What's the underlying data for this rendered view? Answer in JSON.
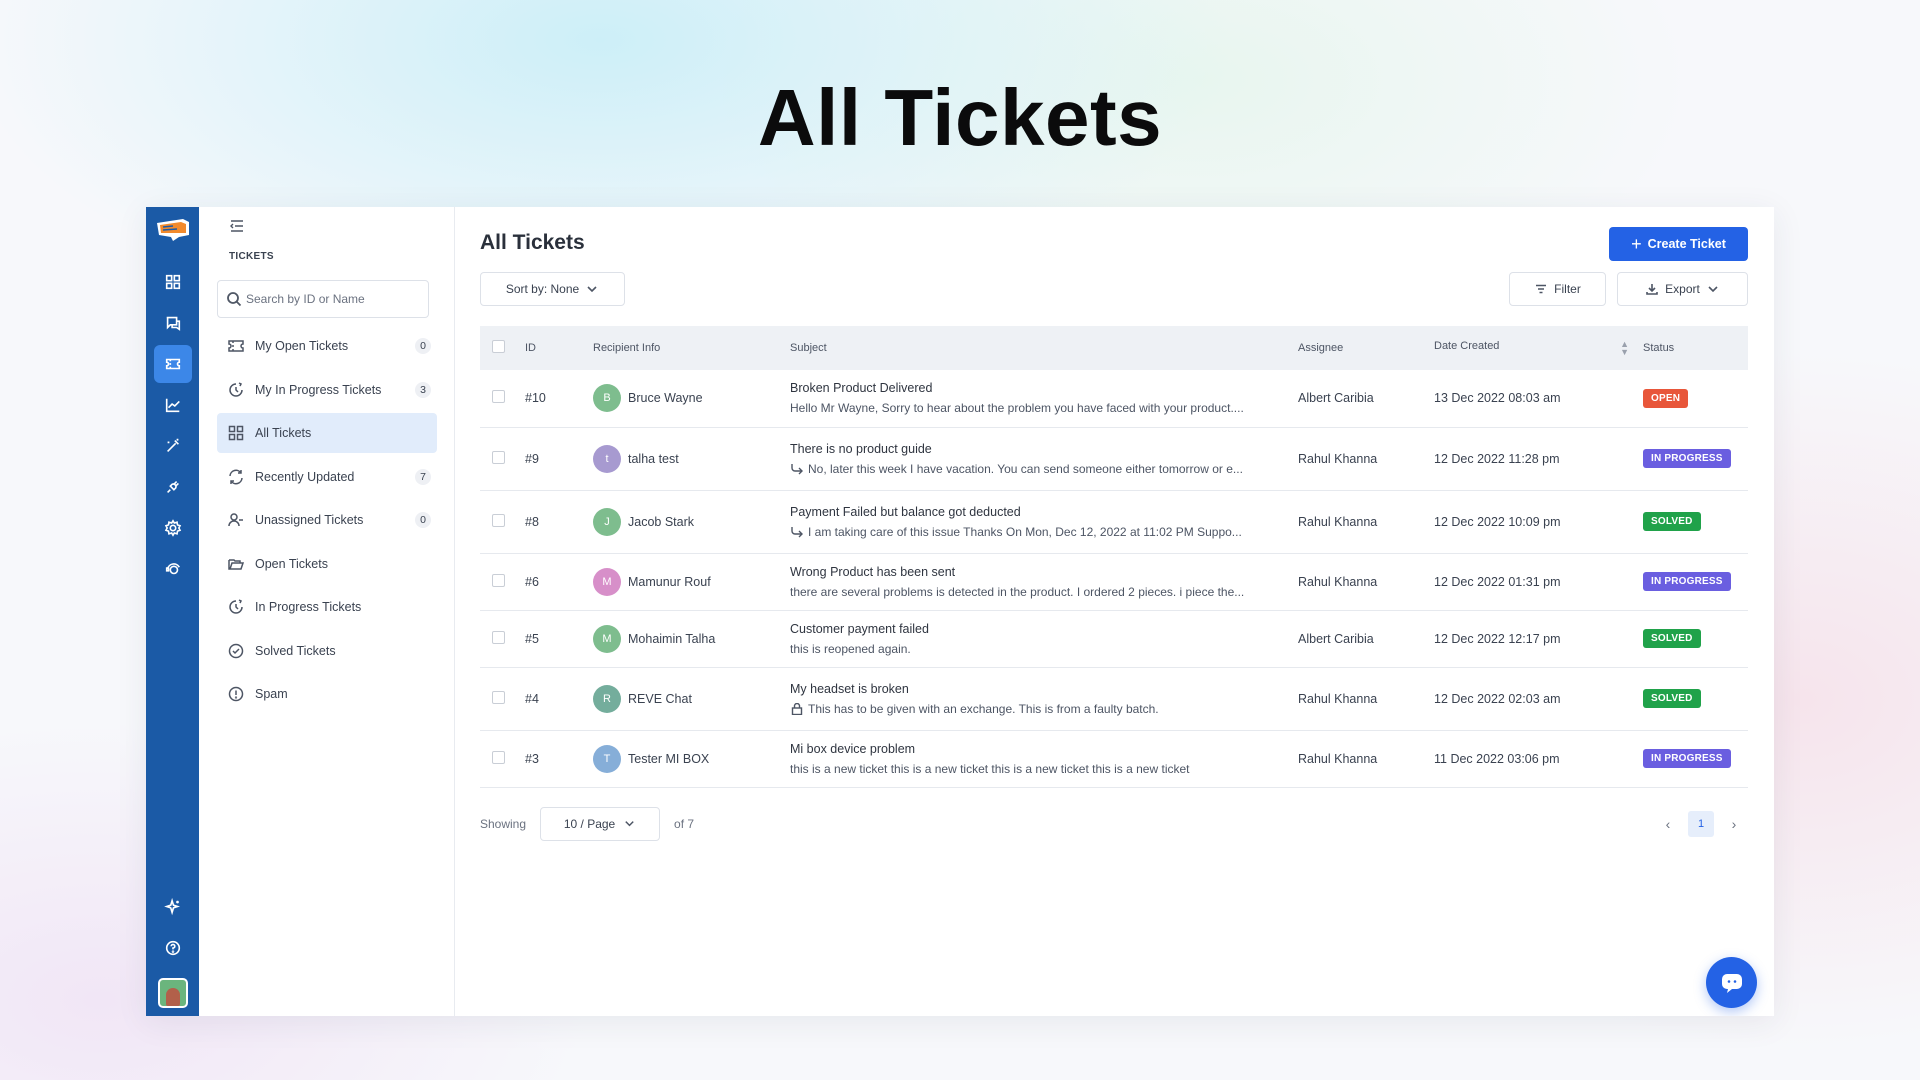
{
  "hero_title": "All Tickets",
  "colors": {
    "rail": "#1b5aa6",
    "primary": "#2462e5",
    "open": "#e8563a",
    "in_progress": "#6a5ee0",
    "solved": "#20a24a"
  },
  "rail": {
    "items": [
      {
        "name": "dashboard-icon"
      },
      {
        "name": "chat-icon"
      },
      {
        "name": "ticket-icon",
        "active": true
      },
      {
        "name": "analytics-icon"
      },
      {
        "name": "magic-wand-icon"
      },
      {
        "name": "plugin-icon"
      },
      {
        "name": "settings-icon"
      },
      {
        "name": "support-agent-icon"
      }
    ],
    "bottom": [
      {
        "name": "sparkle-icon"
      },
      {
        "name": "help-icon"
      }
    ]
  },
  "sidebar": {
    "heading": "TICKETS",
    "search_placeholder": "Search by ID or Name",
    "items": [
      {
        "label": "My Open Tickets",
        "count": "0",
        "icon": "ticket-icon"
      },
      {
        "label": "My In Progress Tickets",
        "count": "3",
        "icon": "progress-icon"
      },
      {
        "label": "All Tickets",
        "count": "",
        "icon": "grid-icon",
        "active": true
      },
      {
        "label": "Recently Updated",
        "count": "7",
        "icon": "refresh-icon"
      },
      {
        "label": "Unassigned Tickets",
        "count": "0",
        "icon": "user-minus-icon"
      },
      {
        "label": "Open Tickets",
        "count": "",
        "icon": "folder-open-icon"
      },
      {
        "label": "In Progress Tickets",
        "count": "",
        "icon": "progress-icon"
      },
      {
        "label": "Solved Tickets",
        "count": "",
        "icon": "check-circle-icon"
      },
      {
        "label": "Spam",
        "count": "",
        "icon": "alert-circle-icon"
      }
    ]
  },
  "main": {
    "title": "All Tickets",
    "create_label": "Create Ticket",
    "sort_label": "Sort by: None",
    "filter_label": "Filter",
    "export_label": "Export"
  },
  "table": {
    "columns": [
      "ID",
      "Recipient Info",
      "Subject",
      "Assignee",
      "Date Created",
      "Status"
    ],
    "rows": [
      {
        "id": "#10",
        "initial": "B",
        "avatar_color": "#7ebd8e",
        "recipient": "Bruce Wayne",
        "subject": "Broken Product Delivered",
        "snippet": "Hello Mr Wayne, Sorry to hear about the problem you have faced with your product....",
        "snippet_icon": "",
        "assignee": "Albert Caribia",
        "date": "13 Dec 2022 08:03 am",
        "status": "OPEN",
        "status_color": "#e8563a"
      },
      {
        "id": "#9",
        "initial": "t",
        "avatar_color": "#a79ad0",
        "recipient": "talha test",
        "subject": "There is no product guide",
        "snippet": "No, later this week I have vacation. You can send someone either tomorrow or e...",
        "snippet_icon": "reply-icon",
        "assignee": "Rahul Khanna",
        "date": "12 Dec 2022 11:28 pm",
        "status": "IN PROGRESS",
        "status_color": "#6a5ee0"
      },
      {
        "id": "#8",
        "initial": "J",
        "avatar_color": "#7ebd8e",
        "recipient": "Jacob Stark",
        "subject": "Payment Failed but balance got deducted",
        "snippet": "I am taking care of this issue Thanks On Mon, Dec 12, 2022 at 11:02 PM Suppo...",
        "snippet_icon": "reply-icon",
        "assignee": "Rahul Khanna",
        "date": "12 Dec 2022 10:09 pm",
        "status": "SOLVED",
        "status_color": "#20a24a"
      },
      {
        "id": "#6",
        "initial": "M",
        "avatar_color": "#d78fc9",
        "recipient": "Mamunur Rouf",
        "subject": "Wrong Product has been sent",
        "snippet": "there are several problems is detected in the product. I ordered 2 pieces. i piece the...",
        "snippet_icon": "",
        "assignee": "Rahul Khanna",
        "date": "12 Dec 2022 01:31 pm",
        "status": "IN PROGRESS",
        "status_color": "#6a5ee0"
      },
      {
        "id": "#5",
        "initial": "M",
        "avatar_color": "#7ebd8e",
        "recipient": "Mohaimin Talha",
        "subject": "Customer payment failed",
        "snippet": "this is reopened again.",
        "snippet_icon": "",
        "assignee": "Albert Caribia",
        "date": "12 Dec 2022 12:17 pm",
        "status": "SOLVED",
        "status_color": "#20a24a"
      },
      {
        "id": "#4",
        "initial": "R",
        "avatar_color": "#74ad9c",
        "recipient": "REVE Chat",
        "subject": "My headset is broken",
        "snippet": "This has to be given with an exchange. This is from a faulty batch.",
        "snippet_icon": "lock-icon",
        "assignee": "Rahul Khanna",
        "date": "12 Dec 2022 02:03 am",
        "status": "SOLVED",
        "status_color": "#20a24a"
      },
      {
        "id": "#3",
        "initial": "T",
        "avatar_color": "#86aed8",
        "recipient": "Tester MI BOX",
        "subject": "Mi box device problem",
        "snippet": "this is a new ticket this is a new ticket this is a new ticket this is a new ticket",
        "snippet_icon": "",
        "assignee": "Rahul Khanna",
        "date": "11 Dec 2022 03:06 pm",
        "status": "IN PROGRESS",
        "status_color": "#6a5ee0"
      }
    ]
  },
  "pager": {
    "showing_label": "Showing",
    "per_page": "10 / Page",
    "of_label": "of 7",
    "current_page": "1"
  }
}
